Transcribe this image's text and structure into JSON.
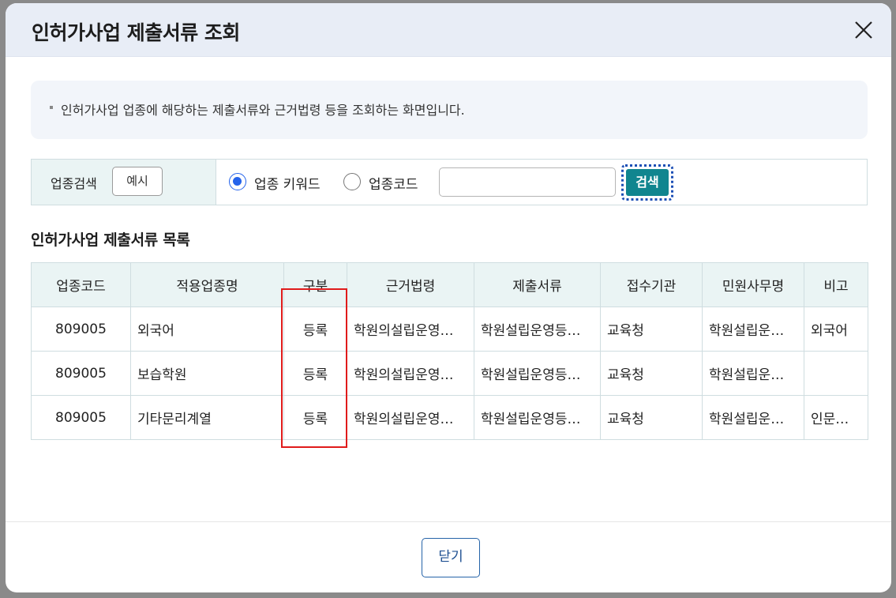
{
  "modal": {
    "title": "인허가사업 제출서류 조회",
    "info_text": "인허가사업 업종에 해당하는 제출서류와 근거법령 등을 조회하는 화면입니다."
  },
  "search": {
    "label": "업종검색",
    "example_button": "예시",
    "radio_options": [
      {
        "label": "업종 키워드",
        "checked": true
      },
      {
        "label": "업종코드",
        "checked": false
      }
    ],
    "input_value": "",
    "search_button": "검색"
  },
  "list": {
    "title": "인허가사업 제출서류 목록",
    "columns": [
      "업종코드",
      "적용업종명",
      "구분",
      "근거법령",
      "제출서류",
      "접수기관",
      "민원사무명",
      "비고"
    ],
    "rows": [
      [
        "809005",
        "외국어",
        "등록",
        "학원의설립운영…",
        "학원설립운영등…",
        "교육청",
        "학원설립운…",
        "외국어"
      ],
      [
        "809005",
        "보습학원",
        "등록",
        "학원의설립운영…",
        "학원설립운영등…",
        "교육청",
        "학원설립운…",
        ""
      ],
      [
        "809005",
        "기타문리계열",
        "등록",
        "학원의설립운영…",
        "학원설립운영등…",
        "교육청",
        "학원설립운…",
        "인문…"
      ]
    ]
  },
  "footer": {
    "close_button": "닫기"
  },
  "colors": {
    "accent": "#10858f",
    "header_bg": "#e8edf6",
    "table_header_bg": "#eaf4f4",
    "highlight": "#e01b1b",
    "radio_checked": "#2563eb"
  }
}
